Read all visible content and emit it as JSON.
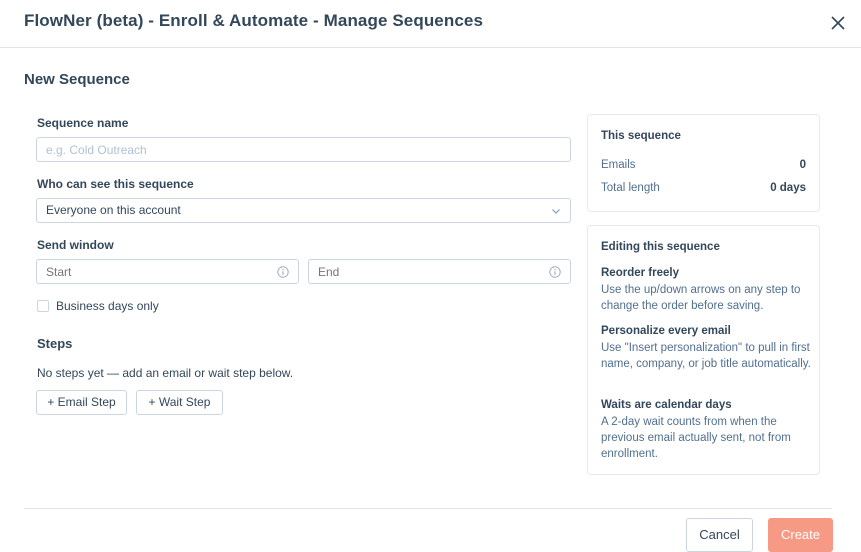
{
  "modal": {
    "title": "FlowNer (beta) - Enroll & Automate - Manage Sequences",
    "section_title": "New Sequence"
  },
  "form": {
    "name_label": "Sequence name",
    "name_placeholder": "e.g. Cold Outreach",
    "name_value": "",
    "visibility_label": "Who can see this sequence",
    "visibility_value": "Everyone on this account",
    "send_window_label": "Send window",
    "start_placeholder": "Start",
    "end_placeholder": "End",
    "business_days_label": "Business days only",
    "business_days_checked": false
  },
  "steps": {
    "title": "Steps",
    "empty_text": "No steps yet — add an email or wait step below.",
    "add_email_label": "+ Email Step",
    "add_wait_label": "+ Wait Step"
  },
  "summary": {
    "title": "This sequence",
    "emails_label": "Emails",
    "emails_value": "0",
    "length_label": "Total length",
    "length_value": "0 days"
  },
  "tips": {
    "title": "Editing this sequence",
    "items": [
      {
        "title": "Reorder freely",
        "body": "Use the up/down arrows on any step to change the order before saving."
      },
      {
        "title": "Personalize every email",
        "body": "Use \"Insert personalization\" to pull in first name, company, or job title automatically."
      },
      {
        "title": "Waits are calendar days",
        "body": "A 2-day wait counts from when the previous email actually sent, not from enrollment."
      }
    ]
  },
  "footer": {
    "cancel_label": "Cancel",
    "create_label": "Create"
  },
  "colors": {
    "primary_text": "#33475b",
    "border": "#cbd6e2",
    "create_button": "#f79a85"
  },
  "icons": {
    "close": "close-icon",
    "chevron": "chevron-down-icon",
    "info": "info-icon"
  }
}
